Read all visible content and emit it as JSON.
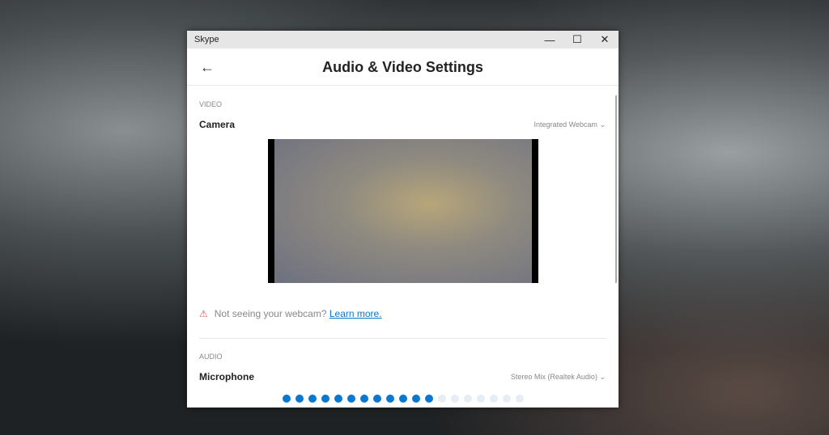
{
  "window": {
    "title": "Skype",
    "minimize": "—",
    "maximize": "☐",
    "close": "✕"
  },
  "header": {
    "title": "Audio & Video Settings",
    "back": "←"
  },
  "video": {
    "section": "VIDEO",
    "camera_label": "Camera",
    "camera_value": "Integrated Webcam",
    "warning_text": "Not seeing your webcam?",
    "warning_link": "Learn more."
  },
  "audio": {
    "section": "AUDIO",
    "mic_label": "Microphone",
    "mic_value": "Stereo Mix (Realtek Audio)"
  },
  "mic_level": {
    "active": 12,
    "total": 19
  },
  "colors": {
    "accent": "#0a78d0",
    "warning": "#e05a4a"
  }
}
